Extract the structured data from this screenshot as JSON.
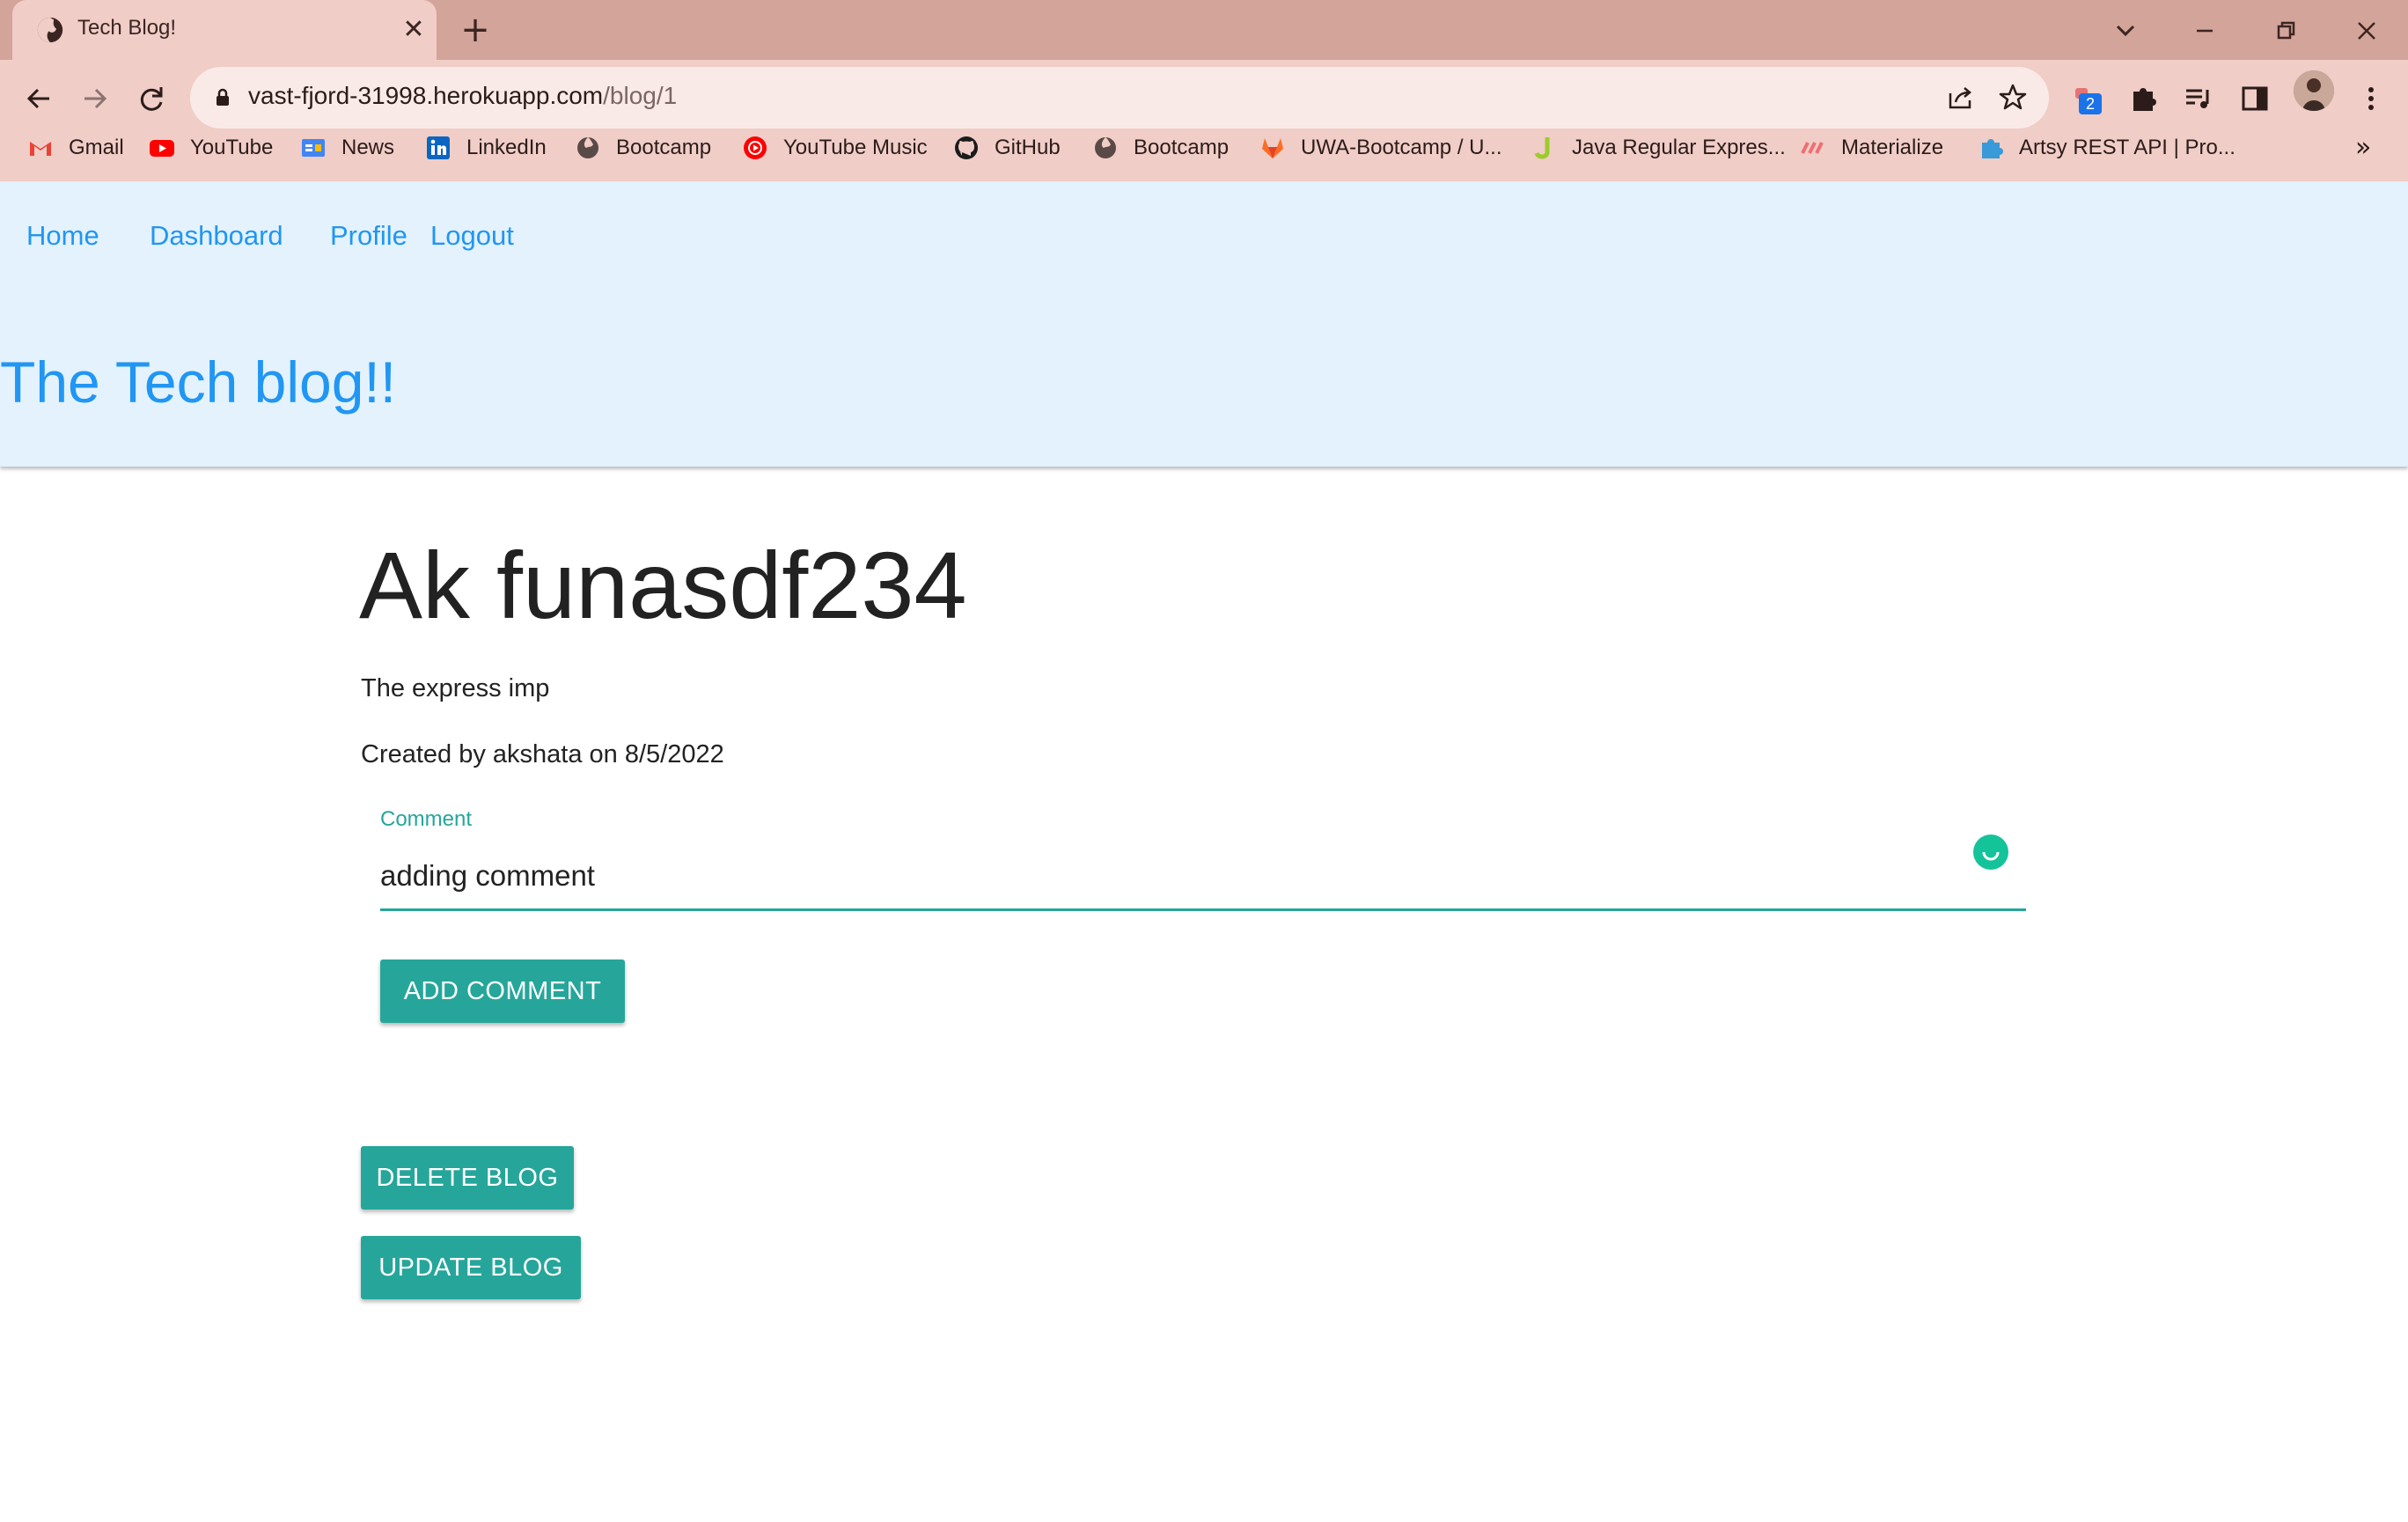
{
  "browser": {
    "tab_title": "Tech Blog!",
    "url_host": "vast-fjord-31998.herokuapp.com",
    "url_path": "/blog/1",
    "extension_badge": "2",
    "bookmarks": [
      {
        "label": "Gmail",
        "icon": "gmail-icon"
      },
      {
        "label": "YouTube",
        "icon": "youtube-icon"
      },
      {
        "label": "News",
        "icon": "google-news-icon"
      },
      {
        "label": "LinkedIn",
        "icon": "linkedin-icon"
      },
      {
        "label": "Bootcamp",
        "icon": "globe-icon"
      },
      {
        "label": "YouTube Music",
        "icon": "youtube-music-icon"
      },
      {
        "label": "GitHub",
        "icon": "github-icon"
      },
      {
        "label": "Bootcamp",
        "icon": "globe-icon"
      },
      {
        "label": "UWA-Bootcamp / U...",
        "icon": "gitlab-icon"
      },
      {
        "label": "Java Regular Expres...",
        "icon": "j-icon"
      },
      {
        "label": "Materialize",
        "icon": "materialize-icon"
      },
      {
        "label": "Artsy REST API | Pro...",
        "icon": "puzzle-icon"
      }
    ],
    "colors": {
      "frame": "#d3a49a",
      "toolbar": "#f0cdc6",
      "omnibox": "#faeae7"
    }
  },
  "site": {
    "nav": {
      "home": "Home",
      "dashboard": "Dashboard",
      "profile": "Profile",
      "logout": "Logout"
    },
    "title": "The Tech blog!!",
    "colors": {
      "header_bg": "#e3f2fd",
      "link": "#2196f3",
      "accent": "#26a69a"
    }
  },
  "post": {
    "title": "Ak funasdf234",
    "body": "The express imp",
    "meta": "Created by akshata on 8/5/2022"
  },
  "comment_form": {
    "label": "Comment",
    "value": "adding comment",
    "submit_label": "ADD COMMENT"
  },
  "actions": {
    "delete_label": "DELETE BLOG",
    "update_label": "UPDATE BLOG"
  }
}
